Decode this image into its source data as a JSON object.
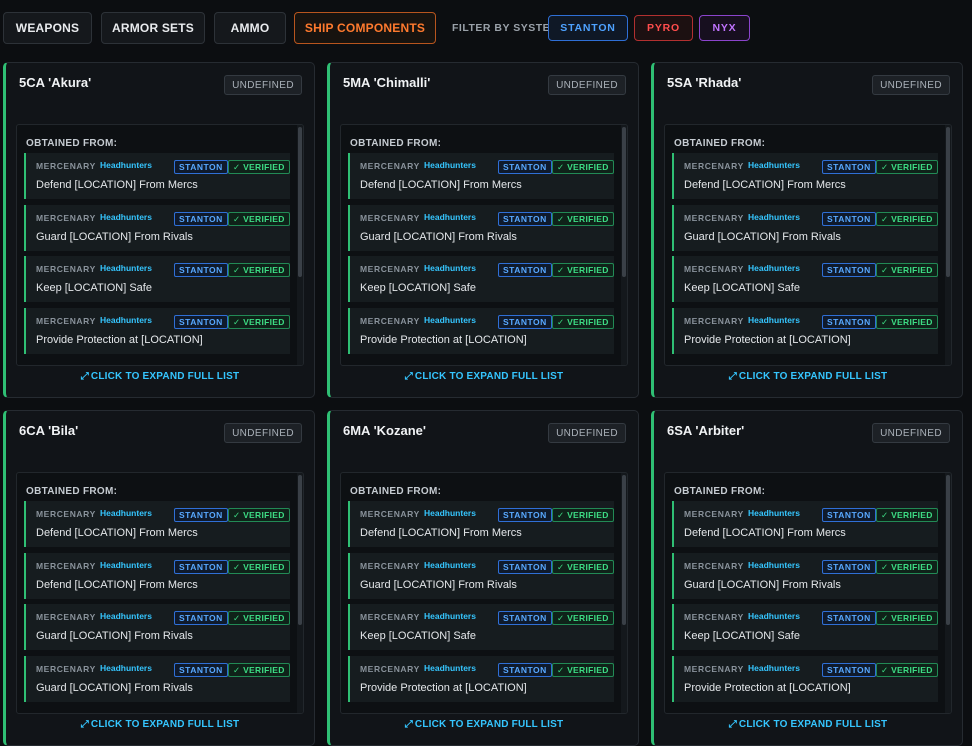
{
  "toolbar": {
    "tabs": [
      {
        "label": "WEAPONS"
      },
      {
        "label": "ARMOR SETS"
      },
      {
        "label": "AMMO"
      },
      {
        "label": "SHIP COMPONENTS"
      }
    ],
    "filter_label": "FILTER BY SYSTEM:",
    "systems": [
      {
        "label": "STANTON",
        "color": "#4ea2ff"
      },
      {
        "label": "PYRO",
        "color": "#ff4d4d"
      },
      {
        "label": "NYX",
        "color": "#c173ff"
      }
    ],
    "active_tab": "SHIP COMPONENTS"
  },
  "cards": [
    {
      "title": "5CA 'Akura'",
      "badge": "UNDEFINED",
      "sources_header": "OBTAINED FROM:",
      "entries": [
        {
          "type": "MERCENARY",
          "faction": "Headhunters",
          "system": "STANTON",
          "status": "✓ VERIFIED",
          "mission": "Defend [LOCATION] From Mercs"
        },
        {
          "type": "MERCENARY",
          "faction": "Headhunters",
          "system": "STANTON",
          "status": "✓ VERIFIED",
          "mission": "Guard [LOCATION] From Rivals"
        },
        {
          "type": "MERCENARY",
          "faction": "Headhunters",
          "system": "STANTON",
          "status": "✓ VERIFIED",
          "mission": "Keep [LOCATION] Safe"
        },
        {
          "type": "MERCENARY",
          "faction": "Headhunters",
          "system": "STANTON",
          "status": "✓ VERIFIED",
          "mission": "Provide Protection at [LOCATION]"
        }
      ],
      "expand_label": "CLICK TO EXPAND FULL LIST"
    },
    {
      "title": "5MA 'Chimalli'",
      "badge": "UNDEFINED",
      "sources_header": "OBTAINED FROM:",
      "entries": [
        {
          "type": "MERCENARY",
          "faction": "Headhunters",
          "system": "STANTON",
          "status": "✓ VERIFIED",
          "mission": "Defend [LOCATION] From Mercs"
        },
        {
          "type": "MERCENARY",
          "faction": "Headhunters",
          "system": "STANTON",
          "status": "✓ VERIFIED",
          "mission": "Guard [LOCATION] From Rivals"
        },
        {
          "type": "MERCENARY",
          "faction": "Headhunters",
          "system": "STANTON",
          "status": "✓ VERIFIED",
          "mission": "Keep [LOCATION] Safe"
        },
        {
          "type": "MERCENARY",
          "faction": "Headhunters",
          "system": "STANTON",
          "status": "✓ VERIFIED",
          "mission": "Provide Protection at [LOCATION]"
        }
      ],
      "expand_label": "CLICK TO EXPAND FULL LIST"
    },
    {
      "title": "5SA 'Rhada'",
      "badge": "UNDEFINED",
      "sources_header": "OBTAINED FROM:",
      "entries": [
        {
          "type": "MERCENARY",
          "faction": "Headhunters",
          "system": "STANTON",
          "status": "✓ VERIFIED",
          "mission": "Defend [LOCATION] From Mercs"
        },
        {
          "type": "MERCENARY",
          "faction": "Headhunters",
          "system": "STANTON",
          "status": "✓ VERIFIED",
          "mission": "Guard [LOCATION] From Rivals"
        },
        {
          "type": "MERCENARY",
          "faction": "Headhunters",
          "system": "STANTON",
          "status": "✓ VERIFIED",
          "mission": "Keep [LOCATION] Safe"
        },
        {
          "type": "MERCENARY",
          "faction": "Headhunters",
          "system": "STANTON",
          "status": "✓ VERIFIED",
          "mission": "Provide Protection at [LOCATION]"
        }
      ],
      "expand_label": "CLICK TO EXPAND FULL LIST"
    },
    {
      "title": "6CA 'Bila'",
      "badge": "UNDEFINED",
      "sources_header": "OBTAINED FROM:",
      "entries": [
        {
          "type": "MERCENARY",
          "faction": "Headhunters",
          "system": "STANTON",
          "status": "✓ VERIFIED",
          "mission": "Defend [LOCATION] From Mercs"
        },
        {
          "type": "MERCENARY",
          "faction": "Headhunters",
          "system": "STANTON",
          "status": "✓ VERIFIED",
          "mission": "Defend [LOCATION] From Mercs"
        },
        {
          "type": "MERCENARY",
          "faction": "Headhunters",
          "system": "STANTON",
          "status": "✓ VERIFIED",
          "mission": "Guard [LOCATION] From Rivals"
        },
        {
          "type": "MERCENARY",
          "faction": "Headhunters",
          "system": "STANTON",
          "status": "✓ VERIFIED",
          "mission": "Guard [LOCATION] From Rivals"
        }
      ],
      "expand_label": "CLICK TO EXPAND FULL LIST"
    },
    {
      "title": "6MA 'Kozane'",
      "badge": "UNDEFINED",
      "sources_header": "OBTAINED FROM:",
      "entries": [
        {
          "type": "MERCENARY",
          "faction": "Headhunters",
          "system": "STANTON",
          "status": "✓ VERIFIED",
          "mission": "Defend [LOCATION] From Mercs"
        },
        {
          "type": "MERCENARY",
          "faction": "Headhunters",
          "system": "STANTON",
          "status": "✓ VERIFIED",
          "mission": "Guard [LOCATION] From Rivals"
        },
        {
          "type": "MERCENARY",
          "faction": "Headhunters",
          "system": "STANTON",
          "status": "✓ VERIFIED",
          "mission": "Keep [LOCATION] Safe"
        },
        {
          "type": "MERCENARY",
          "faction": "Headhunters",
          "system": "STANTON",
          "status": "✓ VERIFIED",
          "mission": "Provide Protection at [LOCATION]"
        }
      ],
      "expand_label": "CLICK TO EXPAND FULL LIST"
    },
    {
      "title": "6SA 'Arbiter'",
      "badge": "UNDEFINED",
      "sources_header": "OBTAINED FROM:",
      "entries": [
        {
          "type": "MERCENARY",
          "faction": "Headhunters",
          "system": "STANTON",
          "status": "✓ VERIFIED",
          "mission": "Defend [LOCATION] From Mercs"
        },
        {
          "type": "MERCENARY",
          "faction": "Headhunters",
          "system": "STANTON",
          "status": "✓ VERIFIED",
          "mission": "Guard [LOCATION] From Rivals"
        },
        {
          "type": "MERCENARY",
          "faction": "Headhunters",
          "system": "STANTON",
          "status": "✓ VERIFIED",
          "mission": "Keep [LOCATION] Safe"
        },
        {
          "type": "MERCENARY",
          "faction": "Headhunters",
          "system": "STANTON",
          "status": "✓ VERIFIED",
          "mission": "Provide Protection at [LOCATION]"
        }
      ],
      "expand_label": "CLICK TO EXPAND FULL LIST"
    }
  ]
}
